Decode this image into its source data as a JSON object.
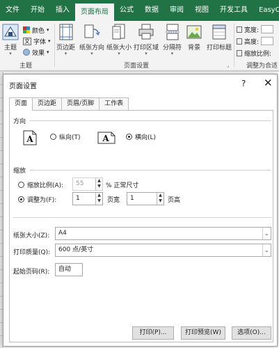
{
  "ribbon": {
    "tabs": [
      "文件",
      "开始",
      "插入",
      "页面布局",
      "公式",
      "数据",
      "审阅",
      "视图",
      "开发工具",
      "EasyO"
    ],
    "active_tab": "页面布局",
    "theme": {
      "main_label": "主题",
      "colors": "颜色",
      "fonts": "字体",
      "effects": "效果",
      "group_label": "主题"
    },
    "page_setup": {
      "margins": "页边距",
      "orientation": "纸张方向",
      "size": "纸张大小",
      "print_area": "打印区域",
      "breaks": "分隔符",
      "background": "背景",
      "print_titles": "打印标题",
      "group_label": "页面设置"
    },
    "scale_to_fit": {
      "width": "宽度:",
      "height": "高度:",
      "scale": "缩放比例:",
      "group_label": "调整为合适"
    }
  },
  "dialog": {
    "title": "页面设置",
    "help": "?",
    "close": "✕",
    "tabs": [
      "页面",
      "页边距",
      "页眉/页脚",
      "工作表"
    ],
    "active_tab": "页面",
    "orientation": {
      "label": "方向",
      "portrait": "纵向(T)",
      "landscape": "横向(L)",
      "selected": "landscape",
      "icon_letter": "A"
    },
    "scaling": {
      "label": "缩放",
      "adjust_to_label": "缩放比例(A):",
      "adjust_value": "55",
      "adjust_suffix": "% 正常尺寸",
      "fit_to_label": "调整为(F):",
      "fit_wide_value": "1",
      "fit_wide_suffix": "页宽",
      "fit_tall_value": "1",
      "fit_tall_suffix": "页高",
      "selected": "fit_to"
    },
    "paper_size": {
      "label": "纸张大小(Z):",
      "value": "A4"
    },
    "print_quality": {
      "label": "打印质量(Q):",
      "value": "600 点/英寸"
    },
    "first_page_number": {
      "label": "起始页码(R):",
      "value": "自动"
    },
    "buttons": {
      "print": "打印(P)...",
      "print_preview": "打印预览(W)",
      "options": "选项(O)..."
    }
  },
  "colors": {
    "ribbon_green": "#217346",
    "focus_blue": "#0078d7"
  }
}
